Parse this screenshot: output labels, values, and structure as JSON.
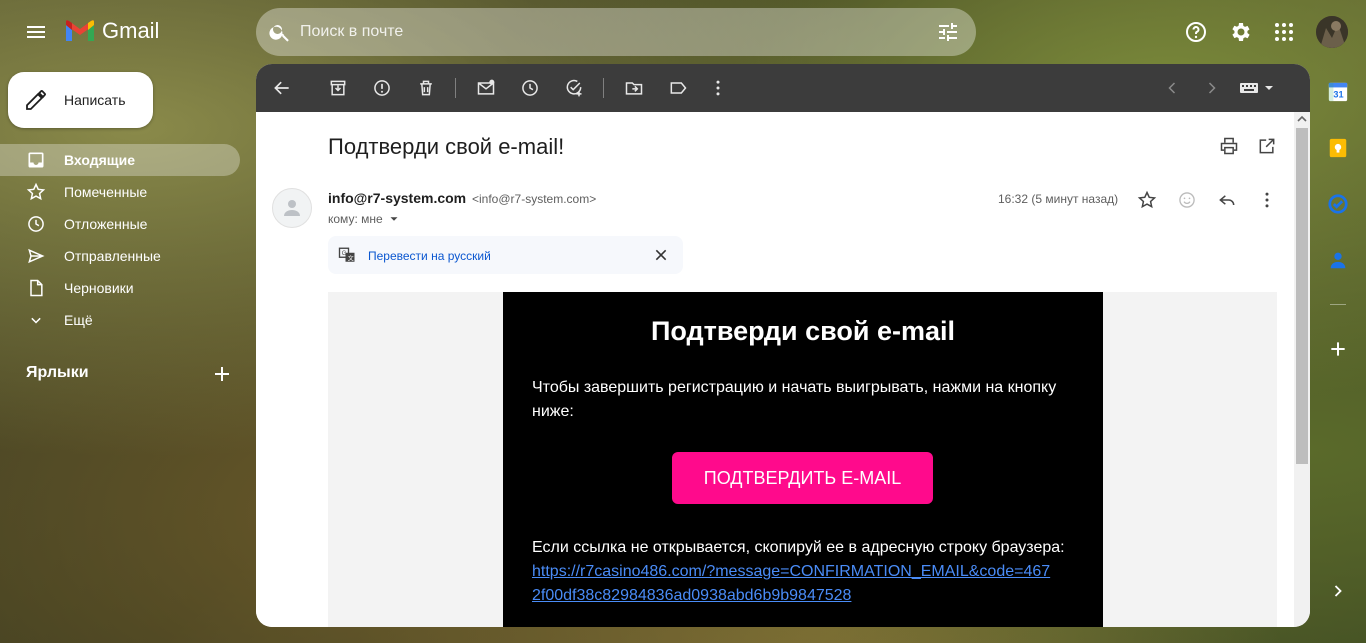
{
  "app": {
    "name": "Gmail"
  },
  "search": {
    "placeholder": "Поиск в почте"
  },
  "sidebar": {
    "compose_label": "Написать",
    "items": [
      {
        "label": "Входящие",
        "icon": "inbox-icon",
        "active": true
      },
      {
        "label": "Помеченные",
        "icon": "star-icon"
      },
      {
        "label": "Отложенные",
        "icon": "clock-icon"
      },
      {
        "label": "Отправленные",
        "icon": "send-icon"
      },
      {
        "label": "Черновики",
        "icon": "draft-icon"
      },
      {
        "label": "Ещё",
        "icon": "chevron-down-icon"
      }
    ],
    "labels_heading": "Ярлыки"
  },
  "message": {
    "subject": "Подтверди свой e-mail!",
    "sender_name": "info@r7-system.com",
    "sender_email": "<info@r7-system.com>",
    "to_line": "кому: мне",
    "time": "16:32 (5 минут назад)",
    "translate_label": "Перевести на русский"
  },
  "email_body": {
    "title": "Подтверди свой e-mail",
    "intro": "Чтобы завершить регистрацию и начать выигрывать, нажми на кнопку ниже:",
    "button_label": "ПОДТВЕРДИТЬ E-MAIL",
    "fallback_text": "Если ссылка не открывается, скопируй ее в адресную строку браузера:",
    "link": "https://r7casino486.com/?message=CONFIRMATION_EMAIL&code=4672f00df38c82984836ad0938abd6b9b9847528"
  },
  "colors": {
    "accent_button": "#ff0a8c",
    "toolbar_bg": "#3c3c3c",
    "link": "#0b57d0"
  }
}
